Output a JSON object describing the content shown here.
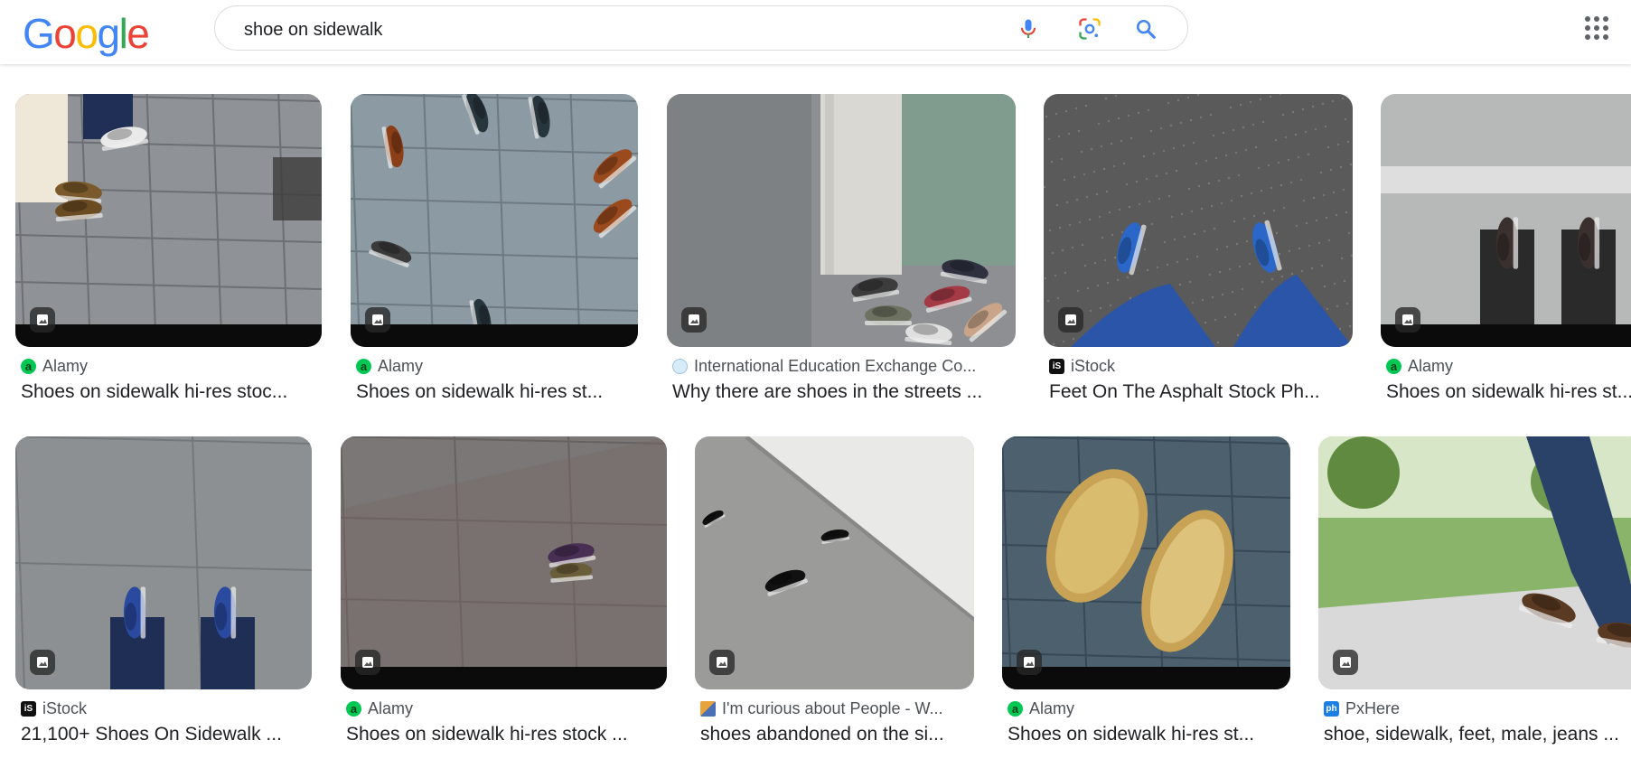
{
  "search": {
    "query": "shoe on sidewalk"
  },
  "logo": {
    "text": "Google",
    "colors": [
      "#4285F4",
      "#EA4335",
      "#FBBC05",
      "#4285F4",
      "#34A853",
      "#EA4335"
    ]
  },
  "icons": {
    "mic": "microphone-icon",
    "lens": "lens-icon",
    "search": "search-icon",
    "apps": "apps-grid-icon",
    "image_badge": "image-icon"
  },
  "results": [
    {
      "source": "Alamy",
      "favicon": "alamy",
      "title": "Shoes on sidewalk hi-res stoc..."
    },
    {
      "source": "Alamy",
      "favicon": "alamy",
      "title": "Shoes on sidewalk hi-res st..."
    },
    {
      "source": "International Education Exchange Co...",
      "favicon": "iee",
      "title": "Why there are shoes in the streets ..."
    },
    {
      "source": "iStock",
      "favicon": "istock",
      "title": "Feet On The Asphalt Stock Ph..."
    },
    {
      "source": "Alamy",
      "favicon": "alamy",
      "title": "Shoes on sidewalk hi-res st..."
    },
    {
      "source": "iStock",
      "favicon": "istock",
      "title": "21,100+ Shoes On Sidewalk ..."
    },
    {
      "source": "Alamy",
      "favicon": "alamy",
      "title": "Shoes on sidewalk hi-res stock ..."
    },
    {
      "source": "I'm curious about People - W...",
      "favicon": "curious",
      "title": "shoes abandoned on the si..."
    },
    {
      "source": "Alamy",
      "favicon": "alamy",
      "title": "Shoes on sidewalk hi-res st..."
    },
    {
      "source": "PxHere",
      "favicon": "pxhere",
      "title": "shoe, sidewalk, feet, male, jeans ..."
    }
  ],
  "favicon_letters": {
    "alamy": "a",
    "istock": "iS",
    "pxhere": "ph",
    "iee": "",
    "curious": ""
  }
}
